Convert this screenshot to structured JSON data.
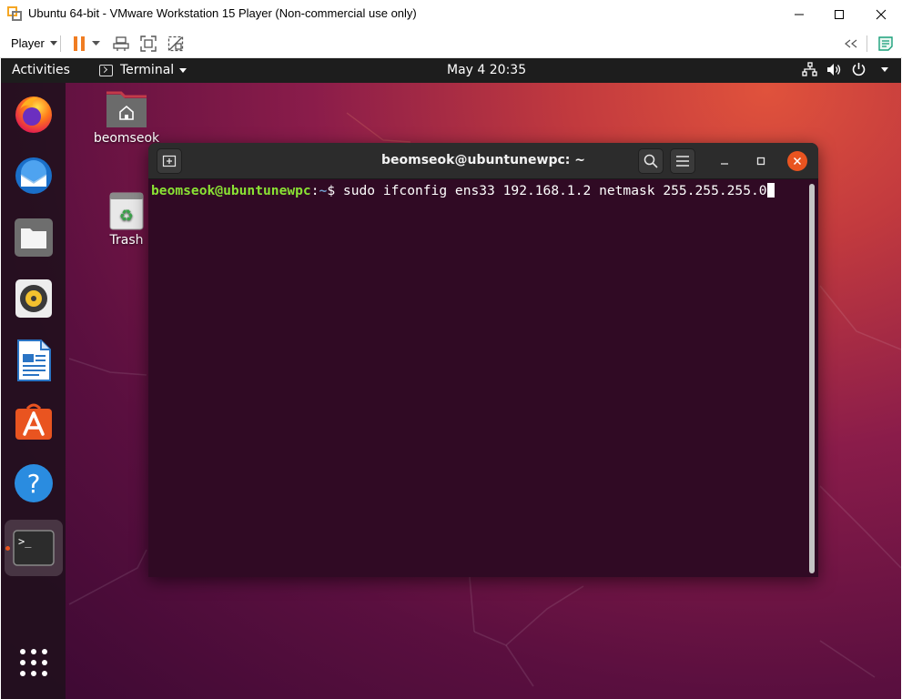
{
  "vm_window": {
    "title": "Ubuntu 64-bit - VMware Workstation 15 Player (Non-commercial use only)",
    "menu_label": "Player",
    "accent_pause": "#f07d22"
  },
  "guest": {
    "topbar": {
      "activities": "Activities",
      "app_menu": "Terminal",
      "clock": "May 4  20:35"
    },
    "dock": {
      "items": [
        "firefox",
        "thunderbird",
        "files",
        "rhythmbox",
        "libreoffice-writer",
        "ubuntu-software",
        "help",
        "terminal"
      ],
      "active_item": "terminal"
    },
    "desktop_icons": {
      "home_label": "beomseok",
      "trash_label": "Trash"
    },
    "terminal": {
      "title": "beomseok@ubuntunewpc: ~",
      "prompt_user": "beomseok@ubuntunewpc",
      "prompt_sep": ":",
      "prompt_path": "~",
      "prompt_symbol": "$ ",
      "command": "sudo ifconfig ens33 192.168.1.2 netmask 255.255.255.0",
      "background": "#300a24"
    }
  }
}
